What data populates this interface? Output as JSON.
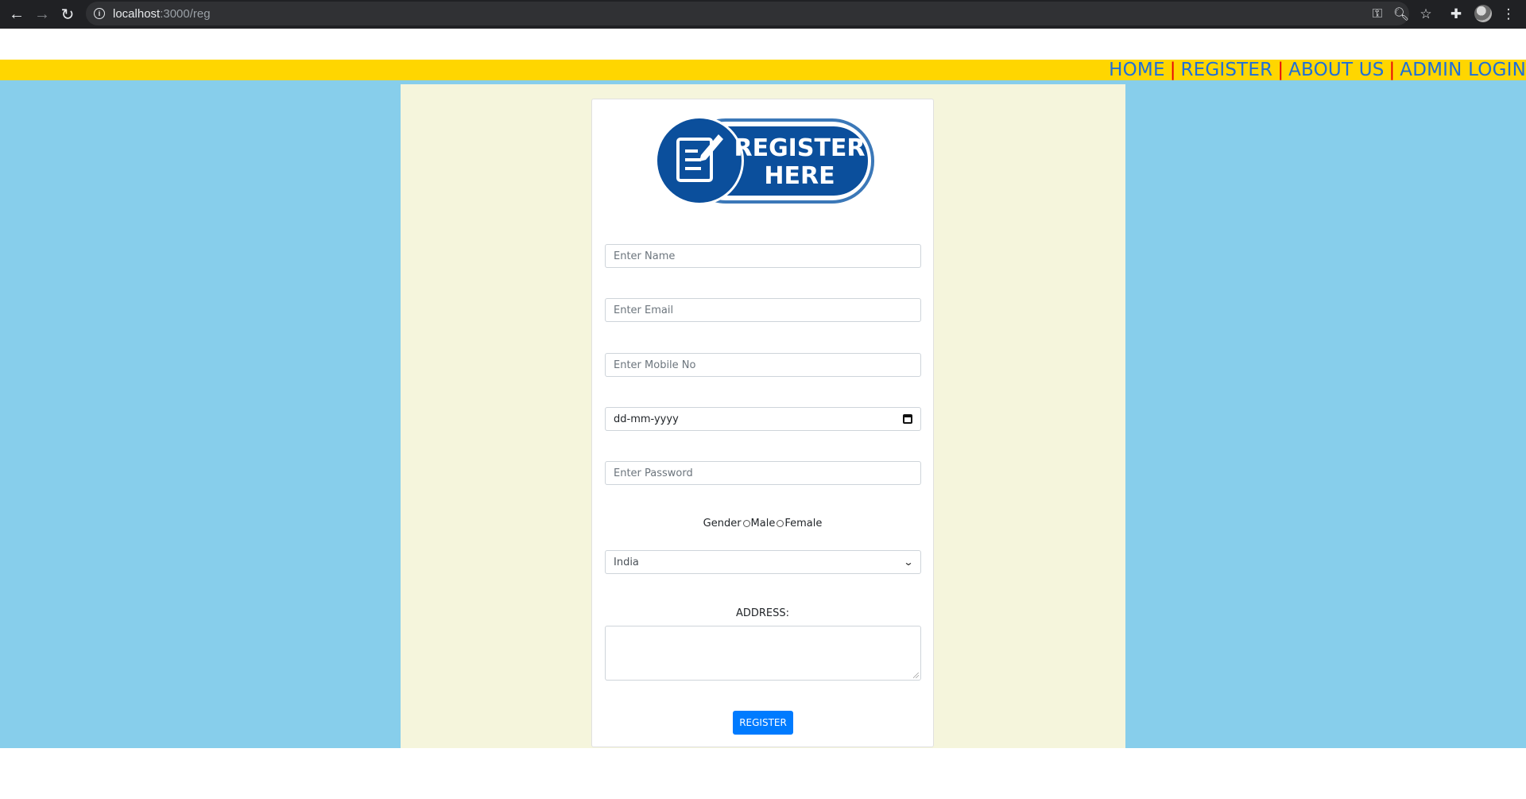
{
  "browser": {
    "url_host": "localhost",
    "url_path": ":3000/reg"
  },
  "nav": {
    "items": [
      "HOME",
      "REGISTER",
      "ABOUT US",
      "ADMIN LOGIN"
    ],
    "separator": "|"
  },
  "logo": {
    "line1": "REGISTER",
    "line2": "HERE"
  },
  "form": {
    "name_placeholder": "Enter Name",
    "email_placeholder": "Enter Email",
    "mobile_placeholder": "Enter Mobile No",
    "date_placeholder": "dd-mm-yyyy",
    "password_placeholder": "Enter Password",
    "gender_label": "Gender",
    "gender_male": "Male",
    "gender_female": "Female",
    "country_selected": "India",
    "address_label": "ADDRESS:",
    "submit_label": "REGISTER"
  },
  "colors": {
    "nav_bar": "#ffd600",
    "nav_link": "#1e6fd9",
    "nav_separator": "#e6000a",
    "page_bg": "#87ceeb",
    "content_bg": "#f5f5dc",
    "button": "#007bff",
    "logo_blue": "#0b4f9c"
  }
}
